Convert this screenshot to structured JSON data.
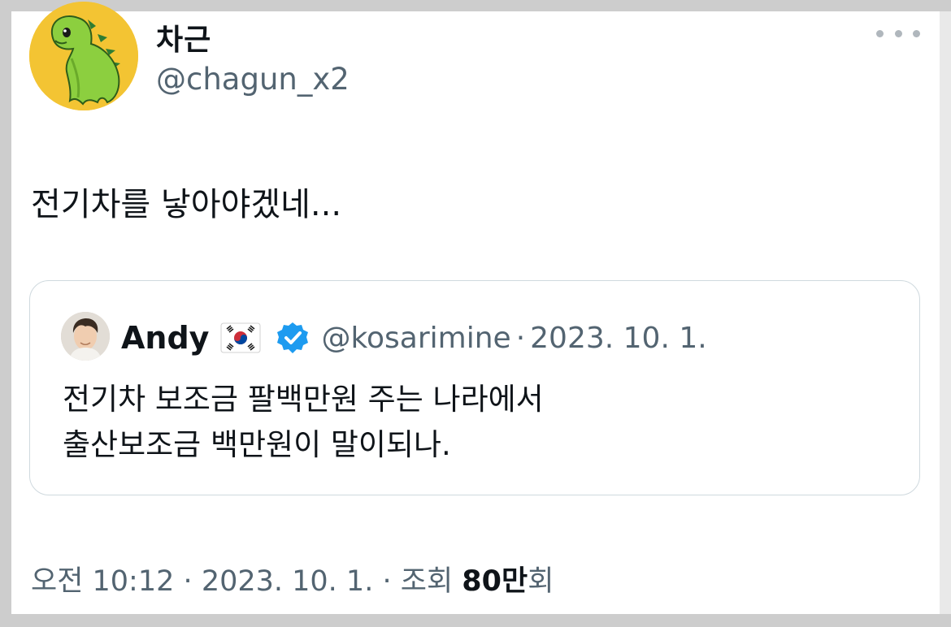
{
  "tweet": {
    "display_name": "차근",
    "handle": "@chagun_x2",
    "avatar_icon": "green-dinosaur-avatar",
    "more_icon": "more-dots-icon",
    "text": "전기차를 낳아야겠네...",
    "meta": {
      "time": "오전 10:12",
      "sep1": "·",
      "date": "2023. 10. 1.",
      "sep2": "·",
      "views_label": "조회",
      "views_count": "80만",
      "views_suffix": "회"
    }
  },
  "quoted": {
    "display_name": "Andy",
    "flag_icon": "south-korea-flag-icon",
    "verified_icon": "verified-badge-icon",
    "handle": "@kosarimine",
    "separator": "·",
    "date": "2023. 10. 1.",
    "text_line1": "전기차 보조금 팔백만원 주는 나라에서",
    "text_line2": "출산보조금 백만원이 말이되나."
  },
  "colors": {
    "avatar_bg": "#f3c433",
    "dino_green": "#8ccf3f",
    "verified_blue": "#1d9bf0",
    "secondary_text": "#536471"
  }
}
